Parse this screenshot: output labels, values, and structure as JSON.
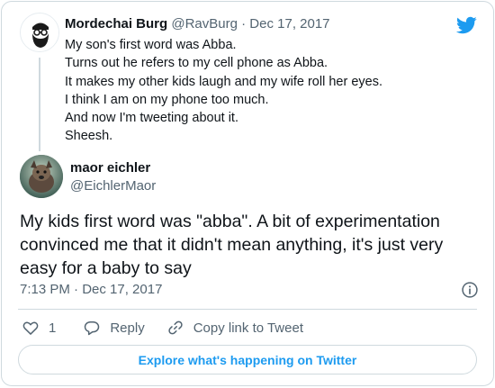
{
  "colors": {
    "brand": "#1d9bf0",
    "text": "#0f1419",
    "muted": "#536471",
    "border": "#cfd9de"
  },
  "icons": {
    "logo": "twitter-bird-icon",
    "info": "info-icon",
    "like": "heart-icon",
    "reply": "reply-bubble-icon",
    "copy": "link-icon"
  },
  "quoted_tweet": {
    "name": "Mordechai Burg",
    "handle": "@RavBurg",
    "separator": "·",
    "date": "Dec 17, 2017",
    "lines": [
      "My son's first word was Abba.",
      "Turns out he refers to my cell phone as Abba.",
      "It makes my other kids laugh and my wife roll her eyes.",
      "I think I am on my phone too much.",
      "And now I'm tweeting about it.",
      "Sheesh."
    ]
  },
  "tweet": {
    "name": "maor eichler",
    "handle": "@EichlerMaor",
    "text_lines": [
      "My kids first word was \"abba\". A bit of experimentation",
      "convinced me that it didn't mean anything, it's just very",
      "easy for a baby to say"
    ],
    "timestamp": "7:13 PM · Dec 17, 2017"
  },
  "actions": {
    "like_count": "1",
    "reply_label": "Reply",
    "copy_label": "Copy link to Tweet"
  },
  "explore_label": "Explore what's happening on Twitter"
}
